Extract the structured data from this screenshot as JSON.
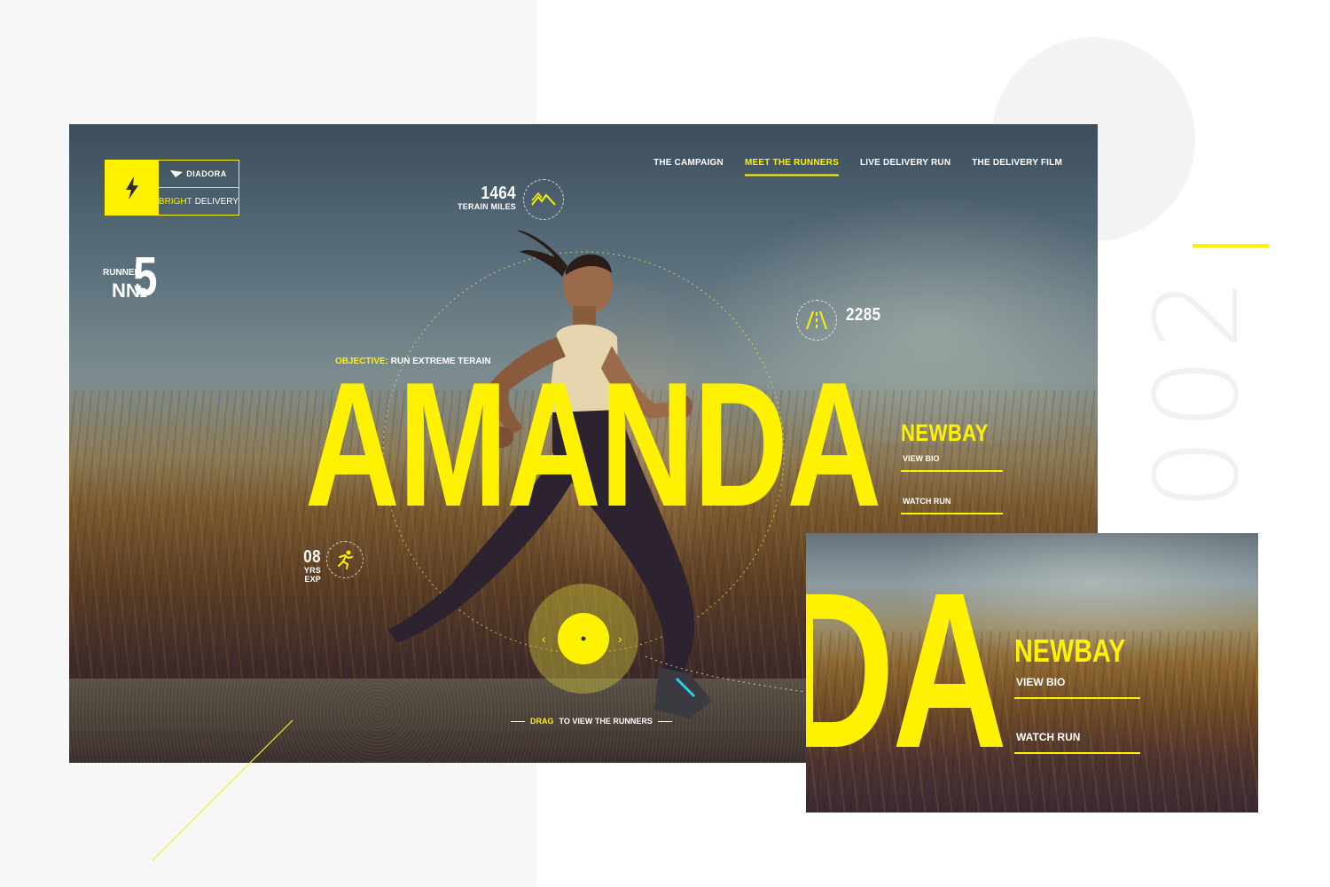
{
  "page": {
    "number_label": "002"
  },
  "colors": {
    "accent": "#fff200",
    "text_light": "#ffffff",
    "background": "#ffffff",
    "panel": "#f7f7f7"
  },
  "logo": {
    "brand": "DIADORA",
    "tag_highlight": "BRIGHT",
    "tag_rest": "DELIVERY",
    "icon": "lightning-bolt-icon"
  },
  "nav": {
    "items": [
      {
        "label": "THE CAMPAIGN",
        "active": false
      },
      {
        "label": "MEET THE RUNNERS",
        "active": true
      },
      {
        "label": "LIVE DELIVERY RUN",
        "active": false
      },
      {
        "label": "THE DELIVERY FILM",
        "active": false
      }
    ]
  },
  "runner": {
    "label": "RUNNER",
    "no_symbol": "N№",
    "number": "5",
    "objective_key": "OBJECTIVE:",
    "objective_value": "RUN EXTREME TERAIN",
    "name": "AMANDA",
    "city": "NEWBAY"
  },
  "stats": {
    "miles": {
      "value": "1464",
      "label": "TERAIN MILES",
      "icon": "mountain-icon"
    },
    "distance": {
      "value": "2285",
      "icon": "road-icon"
    },
    "experience": {
      "value": "08",
      "label": "YRS EXP",
      "icon": "running-figure-icon"
    }
  },
  "links": {
    "view_bio": "VIEW BIO",
    "watch_run": "WATCH RUN"
  },
  "drag": {
    "key": "DRAG",
    "rest": "TO VIEW THE RUNNERS"
  },
  "zoom": {
    "letters": "DA",
    "city": "NEWBAY",
    "view_bio": "VIEW BIO",
    "watch_run": "WATCH RUN"
  }
}
